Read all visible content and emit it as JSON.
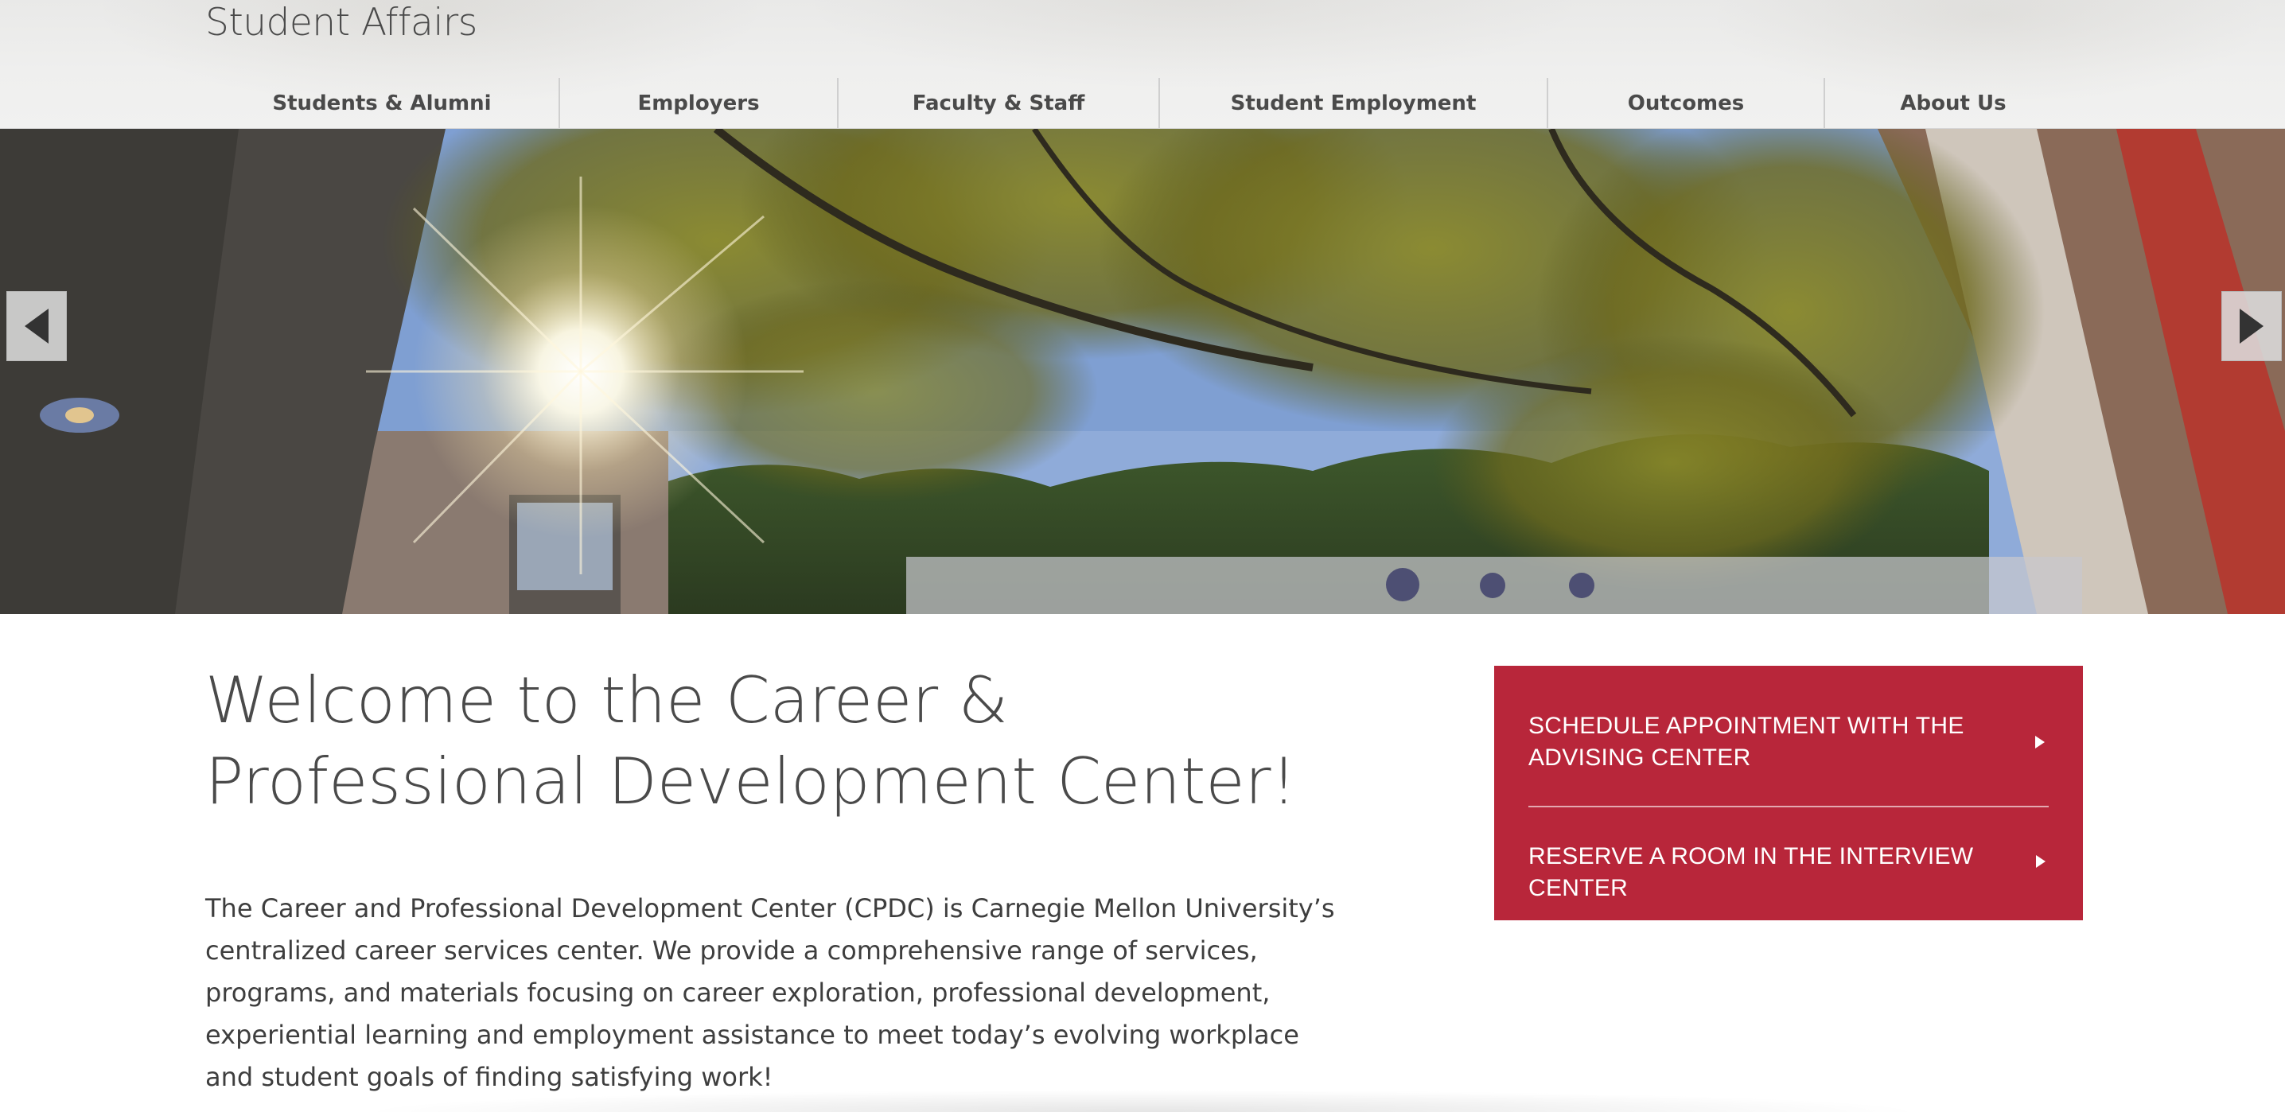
{
  "header": {
    "site_title": "Student Affairs"
  },
  "nav": {
    "items": [
      {
        "label": "Students & Alumni"
      },
      {
        "label": "Employers"
      },
      {
        "label": "Faculty & Staff"
      },
      {
        "label": "Student Employment"
      },
      {
        "label": "Outcomes"
      },
      {
        "label": "About Us"
      }
    ]
  },
  "hero": {
    "image_description_icon": "campus-trees-photo",
    "prev_icon": "triangle-left-icon",
    "next_icon": "triangle-right-icon",
    "slides_total": 3,
    "active_slide": 1
  },
  "main": {
    "heading": "Welcome to the Career & Professional Development Center!",
    "intro": "The Career and Professional Development Center (CPDC) is Carnegie Mellon University’s centralized career services center. We provide a comprehensive range of services, programs, and materials focusing on career exploration, professional development, experiential learning and employment assistance to meet today’s evolving workplace and student goals of finding satisfying work!"
  },
  "cta": {
    "schedule_label": "SCHEDULE APPOINTMENT WITH THE ADVISING CENTER",
    "reserve_label": "RESERVE A ROOM IN THE INTERVIEW CENTER",
    "arrow_icon": "triangle-right-icon"
  },
  "colors": {
    "cta_background": "#b8263a",
    "pager_dot": "#4d4f73",
    "nav_text": "#4a4a4a"
  }
}
